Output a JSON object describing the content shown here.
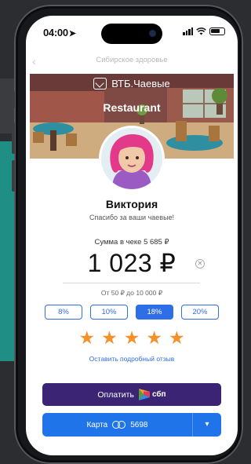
{
  "status": {
    "time": "04:00"
  },
  "navbar": {
    "url": "Сибирское здоровье"
  },
  "brand": {
    "name": "ВТБ.Чаевые"
  },
  "venue": {
    "name": "Restaurant"
  },
  "employee": {
    "name": "Виктория",
    "thanks": "Спасибо за ваши чаевые!"
  },
  "payment": {
    "receipt_label": "Сумма в чеке 5 685 ₽",
    "amount": "1 023 ₽",
    "range": "От 50 ₽ до 10 000 ₽",
    "percents": [
      {
        "label": "8%",
        "selected": false
      },
      {
        "label": "10%",
        "selected": false
      },
      {
        "label": "18%",
        "selected": true
      },
      {
        "label": "20%",
        "selected": false
      }
    ]
  },
  "rating": {
    "stars": 5,
    "max": 5,
    "review_link": "Оставить подробный отзыв"
  },
  "actions": {
    "pay_label": "Оплатить",
    "sbp_label": "сбп",
    "card_label": "Карта",
    "card_number": "5698"
  },
  "colors": {
    "accent_blue": "#2e6ee8",
    "pay_purple": "#3b2473",
    "card_blue": "#1f74ea",
    "star_orange": "#f5902a"
  }
}
